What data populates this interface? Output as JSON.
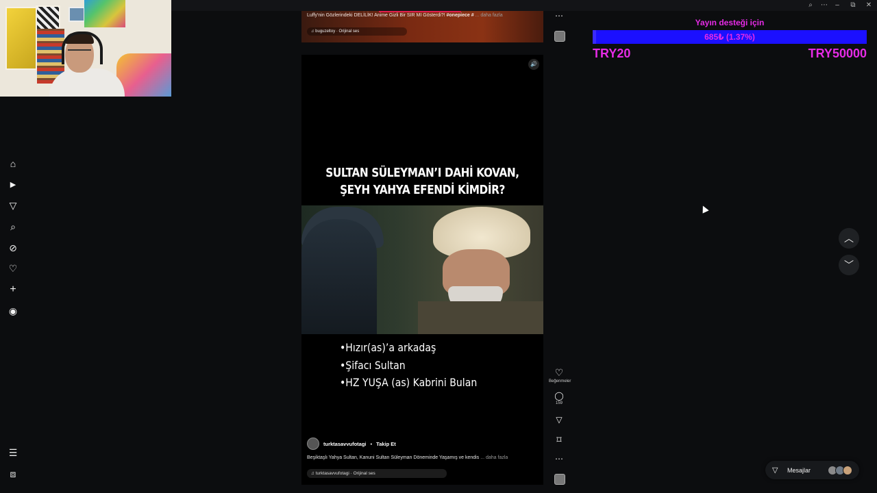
{
  "window": {
    "controls": [
      "⌕",
      "⋯",
      "–",
      "⧉",
      "✕"
    ]
  },
  "left_nav": {
    "items": [
      {
        "icon": "home-icon",
        "glyph": "⌂"
      },
      {
        "icon": "reels-icon",
        "glyph": "▶"
      },
      {
        "icon": "send-icon",
        "glyph": "▽"
      },
      {
        "icon": "search-icon",
        "glyph": "⌕"
      },
      {
        "icon": "explore-icon",
        "glyph": "⊘"
      },
      {
        "icon": "heart-icon",
        "glyph": "♡"
      },
      {
        "icon": "create-icon",
        "glyph": "+"
      },
      {
        "icon": "profile-icon",
        "glyph": "◉"
      }
    ],
    "bottom": [
      {
        "icon": "menu-icon",
        "glyph": "☰"
      },
      {
        "icon": "threads-icon",
        "glyph": "⧈"
      }
    ]
  },
  "prev_reel": {
    "caption_prefix": "Luffy'nin Gözlerindeki DELİLİK! Anime Gizli Bir SIR MI Gösterdi?! ",
    "caption_tag": "#onepiece #",
    "more": "... daha fazla",
    "audio": "♫ buguzeltoy · Orijinal ses"
  },
  "reel": {
    "headline_1": "SULTAN SÜLEYMAN’I DAHİ KOVAN,",
    "headline_2": "ŞEYH YAHYA EFENDİ KİMDİR?",
    "bullet_1": "•Hızır(as)’a arkadaş",
    "bullet_2": "•Şifacı Sultan",
    "bullet_3": "•HZ YUŞA (as) Kabrini Bulan",
    "sound_glyph": "🔊",
    "author": "turktasavvufotagi",
    "separator": "•",
    "follow_label": "Takip Et",
    "description": "Beşiktaşlı Yahya Sultan, Kanuni Sultan Süleyman Döneminde Yaşamış ve kendis",
    "more": "... daha fazla",
    "audio": "♫ turktasavvufotagi · Orijinal ses"
  },
  "actions": {
    "more_top": "⋯",
    "like_glyph": "♡",
    "like_label": "Beğenmeler",
    "comment_glyph": "◯",
    "comment_count": "159",
    "share_glyph": "▽",
    "save_glyph": "⌑",
    "more": "⋯"
  },
  "donation": {
    "title": "Yayın desteği için",
    "progress_text": "685₺ (1.37%)",
    "progress_fraction": 0.0137,
    "min_label": "TRY20",
    "max_label": "TRY50000",
    "text_color": "#e62be6",
    "bar_color": "#1b10ff"
  },
  "scroll_nav": {
    "up_glyph": "︿",
    "down_glyph": "﹀"
  },
  "messages": {
    "icon_glyph": "▽",
    "label": "Mesajlar"
  }
}
